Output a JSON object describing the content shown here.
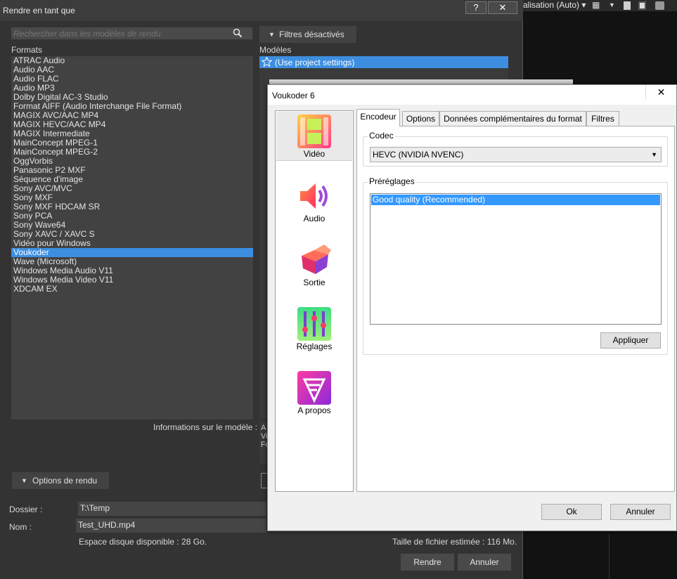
{
  "background_app": {
    "toolbar_text": "alisation (Auto) ▾"
  },
  "render_dialog": {
    "title": "Rendre en tant que",
    "help_button": "?",
    "close_button": "✕",
    "search_placeholder": "Rechercher dans les modèles de rendu",
    "formats_label": "Formats",
    "models_label": "Modèles",
    "filter_button": "Filtres désactivés",
    "formats": [
      "ATRAC Audio",
      "Audio AAC",
      "Audio FLAC",
      "Audio MP3",
      "Dolby Digital AC-3 Studio",
      "Format AIFF (Audio Interchange File Format)",
      "MAGIX AVC/AAC MP4",
      "MAGIX HEVC/AAC MP4",
      "MAGIX Intermediate",
      "MainConcept MPEG-1",
      "MainConcept MPEG-2",
      "OggVorbis",
      "Panasonic P2 MXF",
      "Séquence d'image",
      "Sony AVC/MVC",
      "Sony MXF",
      "Sony MXF HDCAM SR",
      "Sony PCA",
      "Sony Wave64",
      "Sony XAVC / XAVC S",
      "Vidéo pour Windows",
      "Voukoder",
      "Wave (Microsoft)",
      "Windows Media Audio V11",
      "Windows Media Video V11",
      "XDCAM EX"
    ],
    "selected_format": "Voukoder",
    "model_selected": "(Use project settings)",
    "model_info_label": "Informations sur le modèle :",
    "model_info_partial": "A\nVi\nFo",
    "render_options_button": "Options de rendu",
    "folder_label": "Dossier :",
    "folder_value": "T:\\Temp",
    "name_label": "Nom :",
    "name_value": "Test_UHD.mp4",
    "disk_space": "Espace disque disponible : 28 Go.",
    "file_size": "Taille de fichier estimée : 116 Mo.",
    "render_button": "Rendre",
    "cancel_button": "Annuler"
  },
  "voukoder": {
    "title": "Voukoder 6",
    "close_button": "✕",
    "nav": [
      {
        "label": "Vidéo",
        "icon": "video-film-icon"
      },
      {
        "label": "Audio",
        "icon": "speaker-icon"
      },
      {
        "label": "Sortie",
        "icon": "output-box-icon"
      },
      {
        "label": "Réglages",
        "icon": "sliders-icon"
      },
      {
        "label": "A propos",
        "icon": "about-logo-icon"
      }
    ],
    "tabs": [
      "Encodeur",
      "Options",
      "Données complémentaires du format",
      "Filtres"
    ],
    "codec_label": "Codec",
    "codec_value": "HEVC (NVIDIA NVENC)",
    "presets_label": "Préréglages",
    "preset_selected": "Good quality (Recommended)",
    "apply_button": "Appliquer",
    "ok_button": "Ok",
    "cancel_button": "Annuler"
  }
}
